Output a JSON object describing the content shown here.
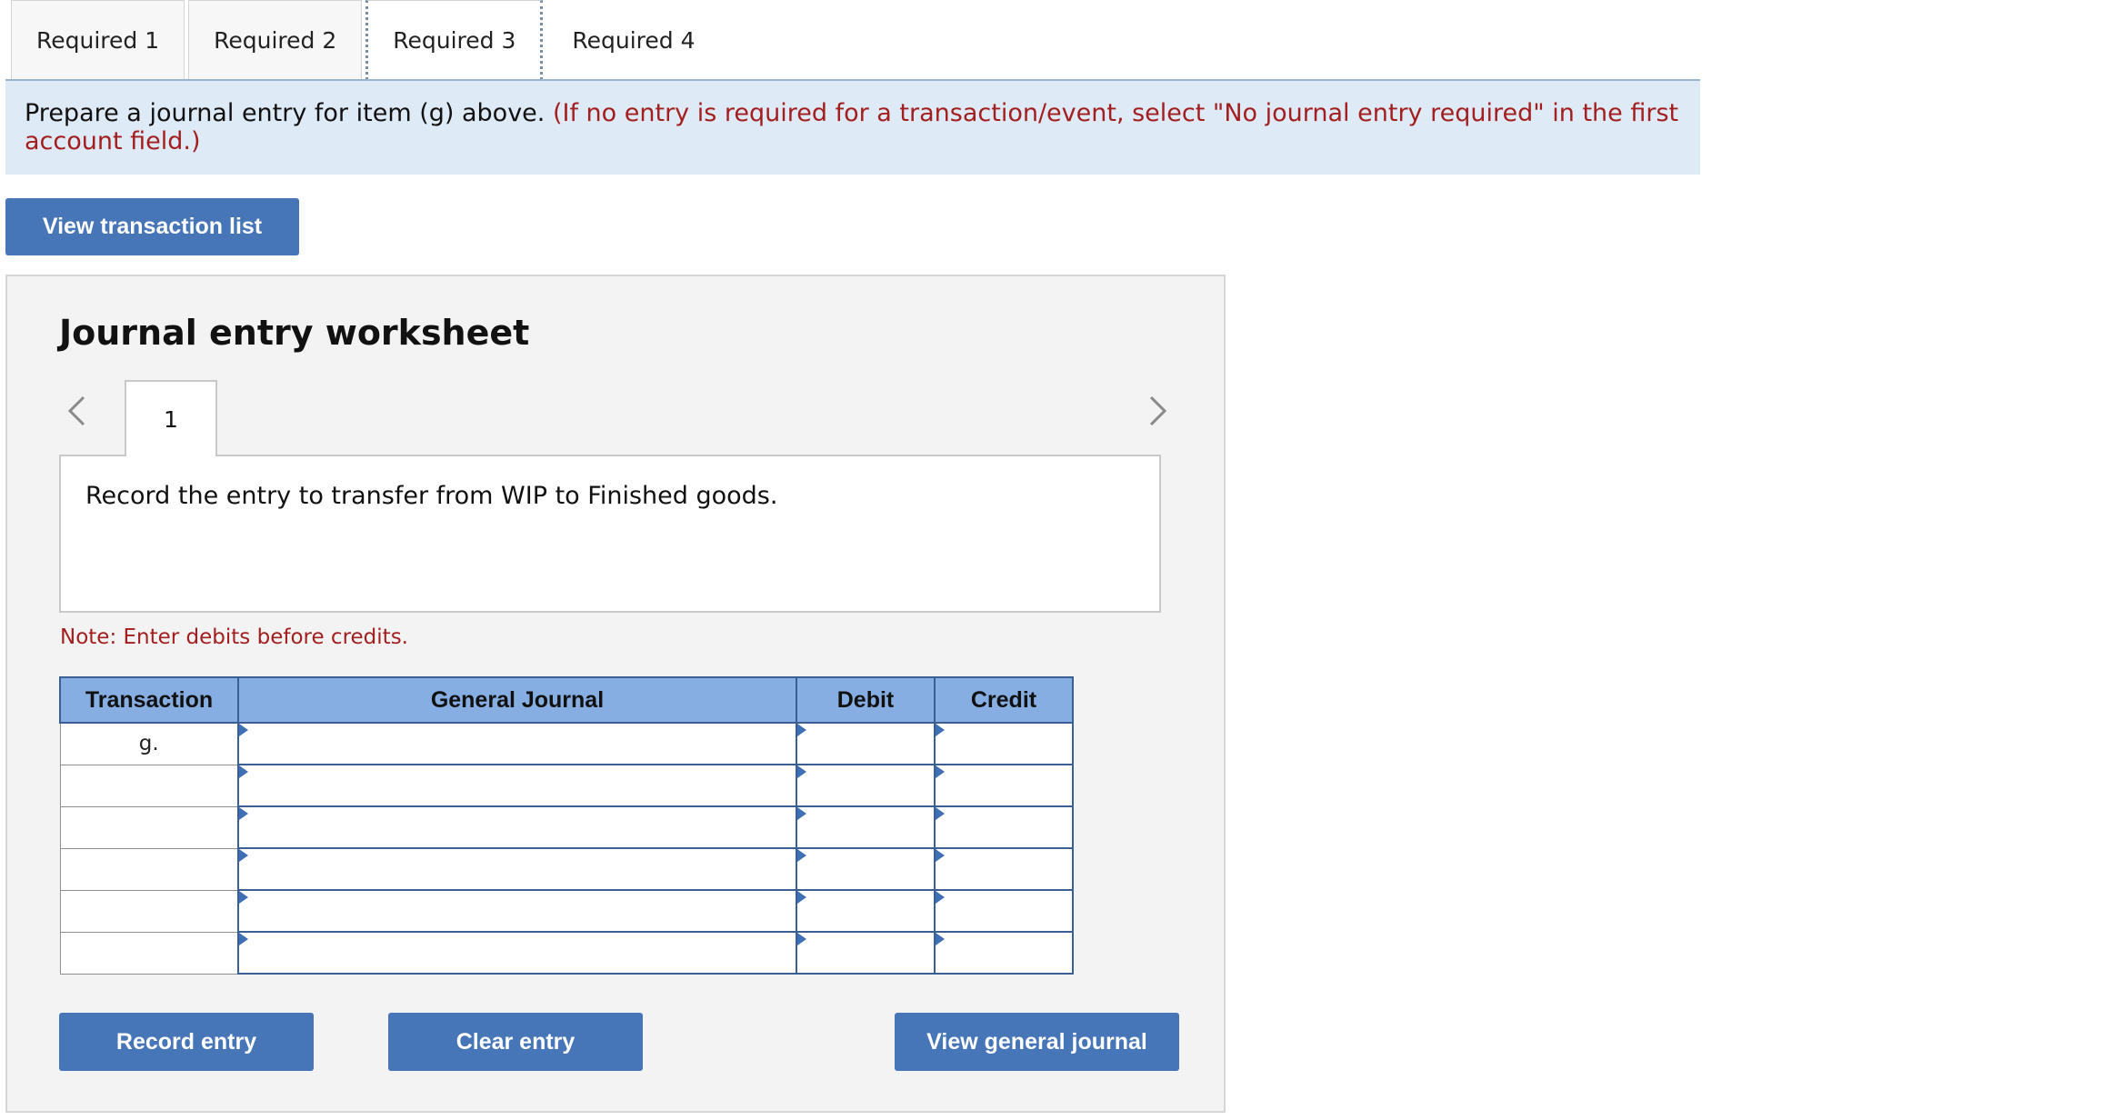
{
  "tabs": [
    {
      "label": "Required 1"
    },
    {
      "label": "Required 2"
    },
    {
      "label": "Required 3"
    },
    {
      "label": "Required 4"
    }
  ],
  "active_tab": "Required 3",
  "instructions": {
    "main": "Prepare a journal entry for item (g) above.",
    "note": "(If no entry is required for a transaction/event, select \"No journal entry required\" in the first account field.)"
  },
  "buttons": {
    "view_transaction_list": "View transaction list",
    "record_entry": "Record entry",
    "clear_entry": "Clear entry",
    "view_general_journal": "View general journal"
  },
  "worksheet": {
    "title": "Journal entry worksheet",
    "current_step": "1",
    "description": "Record the entry to transfer from WIP to Finished goods.",
    "note": "Note: Enter debits before credits."
  },
  "journal_table": {
    "headers": [
      "Transaction",
      "General Journal",
      "Debit",
      "Credit"
    ],
    "rows": [
      {
        "transaction": "g.",
        "account": "",
        "debit": "",
        "credit": ""
      },
      {
        "transaction": "",
        "account": "",
        "debit": "",
        "credit": ""
      },
      {
        "transaction": "",
        "account": "",
        "debit": "",
        "credit": ""
      },
      {
        "transaction": "",
        "account": "",
        "debit": "",
        "credit": ""
      },
      {
        "transaction": "",
        "account": "",
        "debit": "",
        "credit": ""
      },
      {
        "transaction": "",
        "account": "",
        "debit": "",
        "credit": ""
      }
    ]
  },
  "icons": {
    "prev": "chevron-left-icon",
    "next": "chevron-right-icon"
  },
  "colors": {
    "button_blue": "#4675b8",
    "header_blue": "#86aee2",
    "instruction_bg": "#dfeaf7",
    "instruction_red": "#a31e1e",
    "panel_bg": "#f3f3f3"
  }
}
